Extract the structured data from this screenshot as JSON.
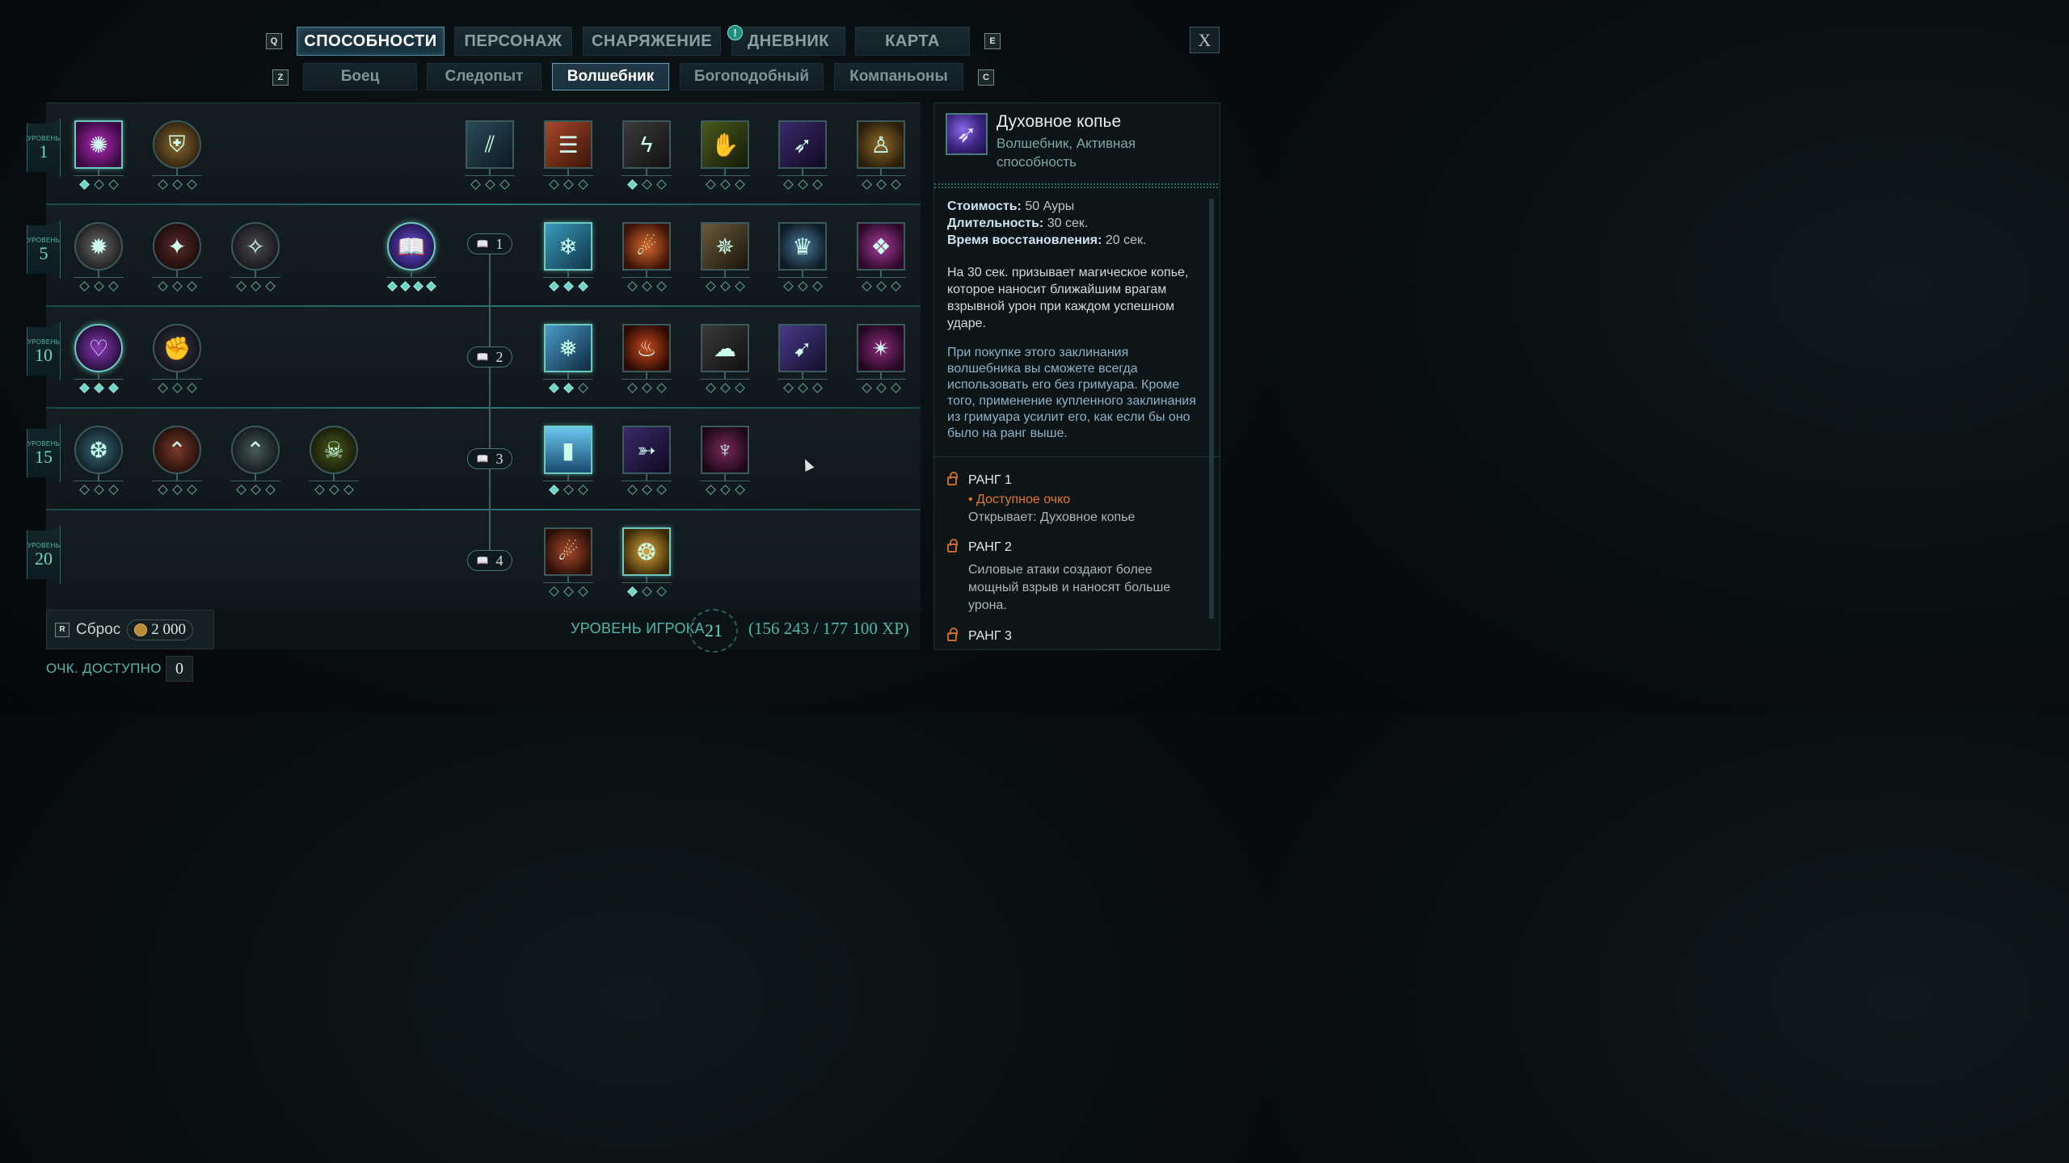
{
  "nav": {
    "key_prev": "Q",
    "key_next": "E",
    "tabs": [
      {
        "label": "СПОСОБНОСТИ",
        "active": true
      },
      {
        "label": "ПЕРСОНАЖ",
        "active": false
      },
      {
        "label": "СНАРЯЖЕНИЕ",
        "active": false
      },
      {
        "label": "ДНЕВНИК",
        "active": false,
        "notice": "!"
      },
      {
        "label": "КАРТА",
        "active": false
      }
    ],
    "close_label": "X"
  },
  "subnav": {
    "key_prev": "Z",
    "key_next": "C",
    "tabs": [
      {
        "label": "Боец",
        "active": false
      },
      {
        "label": "Следопыт",
        "active": false
      },
      {
        "label": "Волшебник",
        "active": true
      },
      {
        "label": "Богоподобный",
        "active": false
      },
      {
        "label": "Компаньоны",
        "active": false
      }
    ]
  },
  "tree": {
    "levels": [
      {
        "label": "УРОВЕНЬ",
        "value": "1"
      },
      {
        "label": "УРОВЕНЬ",
        "value": "5"
      },
      {
        "label": "УРОВЕНЬ",
        "value": "10"
      },
      {
        "label": "УРОВЕНЬ",
        "value": "15"
      },
      {
        "label": "УРОВЕНЬ",
        "value": "20"
      }
    ],
    "gates": [
      {
        "icon": "grimoire-icon",
        "value": "1"
      },
      {
        "icon": "grimoire-icon",
        "value": "2"
      },
      {
        "icon": "grimoire-icon",
        "value": "3"
      },
      {
        "icon": "grimoire-icon",
        "value": "4"
      }
    ]
  },
  "bottom": {
    "reset_key": "R",
    "reset_label": "Сброс",
    "reset_cost": "2 000",
    "player_level_label": "УРОВЕНЬ ИГРОКА",
    "player_level": "21",
    "xp": "(156 243 / 177 100 XP)",
    "points_label": "ОЧК. ДОСТУПНО",
    "points_value": "0"
  },
  "detail": {
    "title": "Духовное копье",
    "subtitle": "Волшебник, Активная способность",
    "stats": [
      {
        "label": "Стоимость:",
        "value": "50 Ауры"
      },
      {
        "label": "Длительность:",
        "value": "30 сек."
      },
      {
        "label": "Время восстановления:",
        "value": "20 сек."
      }
    ],
    "description": "На 30 сек. призывает магическое копье, которое наносит ближайшим врагам взрывной урон при каждом успешном ударе.",
    "note": "При покупке этого заклинания волшебника вы сможете всегда использовать его без гримуара. Кроме того, применение купленного заклинания из гримуара усилит его, как если бы оно было на ранг выше.",
    "ranks": [
      {
        "title": "РАНГ 1",
        "point": "• Доступное очко",
        "text": "Открывает: Духовное копье"
      },
      {
        "title": "РАНГ 2",
        "text": "Силовые атаки создают более мощный взрыв и наносят больше урона."
      },
      {
        "title": "РАНГ 3"
      }
    ]
  }
}
